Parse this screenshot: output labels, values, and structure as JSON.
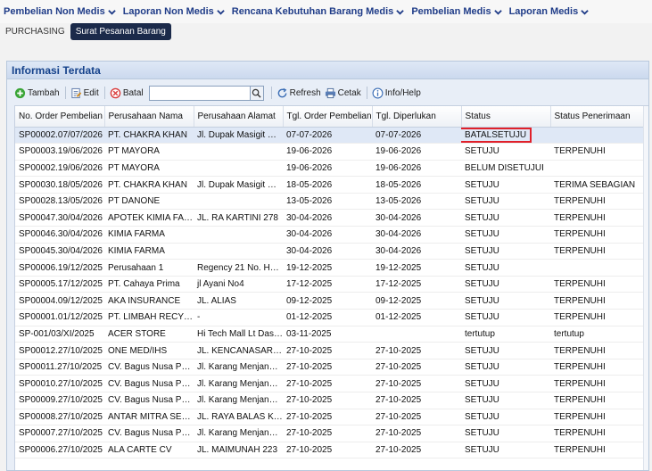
{
  "top_menu": [
    {
      "label": "Pembelian Non Medis"
    },
    {
      "label": "Laporan Non Medis"
    },
    {
      "label": "Rencana Kebutuhan Barang Medis"
    },
    {
      "label": "Pembelian Medis"
    },
    {
      "label": "Laporan Medis"
    }
  ],
  "subnav": {
    "section": "PURCHASING",
    "active": "Surat Pesanan Barang"
  },
  "panel": {
    "title": "Informasi Terdata"
  },
  "toolbar": {
    "add": "Tambah",
    "edit": "Edit",
    "cancel": "Batal",
    "search_value": "",
    "refresh": "Refresh",
    "print": "Cetak",
    "info": "Info/Help"
  },
  "columns": [
    "No. Order Pembelian",
    "Perusahaan Nama",
    "Perusahaan Alamat",
    "Tgl. Order Pembelian",
    "Tgl. Diperlukan",
    "Status",
    "Status Penerimaan"
  ],
  "rows": [
    [
      "SP00002.07/07/2026",
      "PT. CHAKRA KHAN",
      "Jl. Dupak Masigit No...",
      "07-07-2026",
      "07-07-2026",
      "BATALSETUJU",
      ""
    ],
    [
      "SP00003.19/06/2026",
      "PT MAYORA",
      "",
      "19-06-2026",
      "19-06-2026",
      "SETUJU",
      "TERPENUHI"
    ],
    [
      "SP00002.19/06/2026",
      "PT MAYORA",
      "",
      "19-06-2026",
      "19-06-2026",
      "BELUM DISETUJUI",
      ""
    ],
    [
      "SP00030.18/05/2026",
      "PT. CHAKRA KHAN",
      "Jl. Dupak Masigit No...",
      "18-05-2026",
      "18-05-2026",
      "SETUJU",
      "TERIMA SEBAGIAN"
    ],
    [
      "SP00028.13/05/2026",
      "PT DANONE",
      "",
      "13-05-2026",
      "13-05-2026",
      "SETUJU",
      "TERPENUHI"
    ],
    [
      "SP00047.30/04/2026",
      "APOTEK KIMIA FARMA",
      "JL. RA KARTINI 278",
      "30-04-2026",
      "30-04-2026",
      "SETUJU",
      "TERPENUHI"
    ],
    [
      "SP00046.30/04/2026",
      "KIMIA FARMA",
      "",
      "30-04-2026",
      "30-04-2026",
      "SETUJU",
      "TERPENUHI"
    ],
    [
      "SP00045.30/04/2026",
      "KIMIA FARMA",
      "",
      "30-04-2026",
      "30-04-2026",
      "SETUJU",
      "TERPENUHI"
    ],
    [
      "SP00006.19/12/2025",
      "Perusahaan 1",
      "Regency 21 No. H34 ...",
      "19-12-2025",
      "19-12-2025",
      "SETUJU",
      ""
    ],
    [
      "SP00005.17/12/2025",
      "PT. Cahaya Prima",
      "jl Ayani No4",
      "17-12-2025",
      "17-12-2025",
      "SETUJU",
      "TERPENUHI"
    ],
    [
      "SP00004.09/12/2025",
      "AKA INSURANCE",
      "JL. ALIAS",
      "09-12-2025",
      "09-12-2025",
      "SETUJU",
      "TERPENUHI"
    ],
    [
      "SP00001.01/12/2025",
      "PT. LIMBAH RECYCLE",
      "-",
      "01-12-2025",
      "01-12-2025",
      "SETUJU",
      "TERPENUHI"
    ],
    [
      "SP-001/03/XI/2025",
      "ACER STORE",
      "Hi Tech Mall Lt Dasar...",
      "03-11-2025",
      "",
      "tertutup",
      "tertutup"
    ],
    [
      "SP00012.27/10/2025",
      "ONE MED/IHS",
      "JL. KENCANASARI B...",
      "27-10-2025",
      "27-10-2025",
      "SETUJU",
      "TERPENUHI"
    ],
    [
      "SP00011.27/10/2025",
      "CV. Bagus Nusa Pers...",
      "Jl. Karang Menjanga...",
      "27-10-2025",
      "27-10-2025",
      "SETUJU",
      "TERPENUHI"
    ],
    [
      "SP00010.27/10/2025",
      "CV. Bagus Nusa Pers...",
      "Jl. Karang Menjanga...",
      "27-10-2025",
      "27-10-2025",
      "SETUJU",
      "TERPENUHI"
    ],
    [
      "SP00009.27/10/2025",
      "CV. Bagus Nusa Pers...",
      "Jl. Karang Menjanga...",
      "27-10-2025",
      "27-10-2025",
      "SETUJU",
      "TERPENUHI"
    ],
    [
      "SP00008.27/10/2025",
      "ANTAR MITRA SEMB...",
      "JL. RAYA BALAS KLU...",
      "27-10-2025",
      "27-10-2025",
      "SETUJU",
      "TERPENUHI"
    ],
    [
      "SP00007.27/10/2025",
      "CV. Bagus Nusa Pers...",
      "Jl. Karang Menjanga...",
      "27-10-2025",
      "27-10-2025",
      "SETUJU",
      "TERPENUHI"
    ],
    [
      "SP00006.27/10/2025",
      "ALA CARTE CV",
      "JL. MAIMUNAH 223",
      "27-10-2025",
      "27-10-2025",
      "SETUJU",
      "TERPENUHI"
    ]
  ],
  "colors": {
    "menu_text": "#1f3c88",
    "panel_title": "#15428b",
    "selected_row": "#dfe8f6",
    "highlight_box": "#e0202a",
    "subnav_button": "#1b2a4a"
  }
}
